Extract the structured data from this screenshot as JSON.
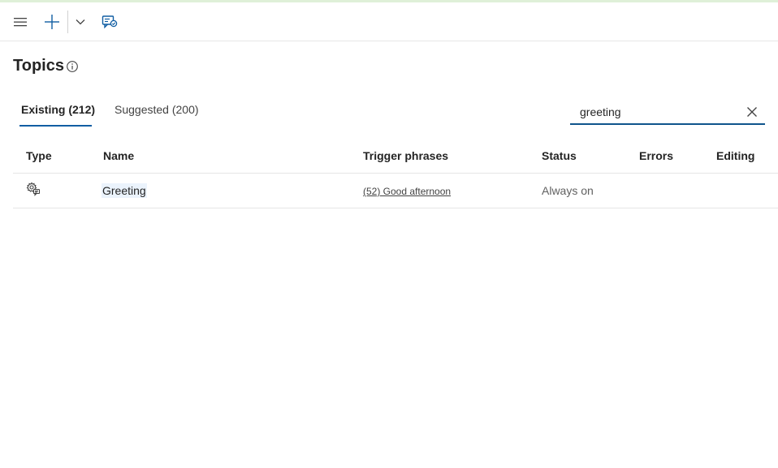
{
  "toolbar": {
    "menu_icon": "hamburger-menu-icon",
    "add_icon": "plus-icon",
    "dropdown_icon": "chevron-down-icon",
    "chat_icon": "chat-test-icon"
  },
  "page": {
    "title": "Topics",
    "info_icon": "info-icon"
  },
  "tabs": [
    {
      "label": "Existing (212)",
      "active": true
    },
    {
      "label": "Suggested (200)",
      "active": false
    }
  ],
  "search": {
    "value": "greeting",
    "clear_icon": "close-icon"
  },
  "table": {
    "headers": {
      "type": "Type",
      "name": "Name",
      "trigger": "Trigger phrases",
      "status": "Status",
      "errors": "Errors",
      "editing": "Editing"
    },
    "rows": [
      {
        "type_icon": "system-topic-gear-icon",
        "name": "Greeting",
        "trigger": "(52) Good afternoon",
        "status": "Always on",
        "errors": "",
        "editing": ""
      }
    ]
  },
  "colors": {
    "accent": "#115ea3",
    "top_bar": "#dff0d8",
    "name_highlight": "#ebf3fc"
  }
}
